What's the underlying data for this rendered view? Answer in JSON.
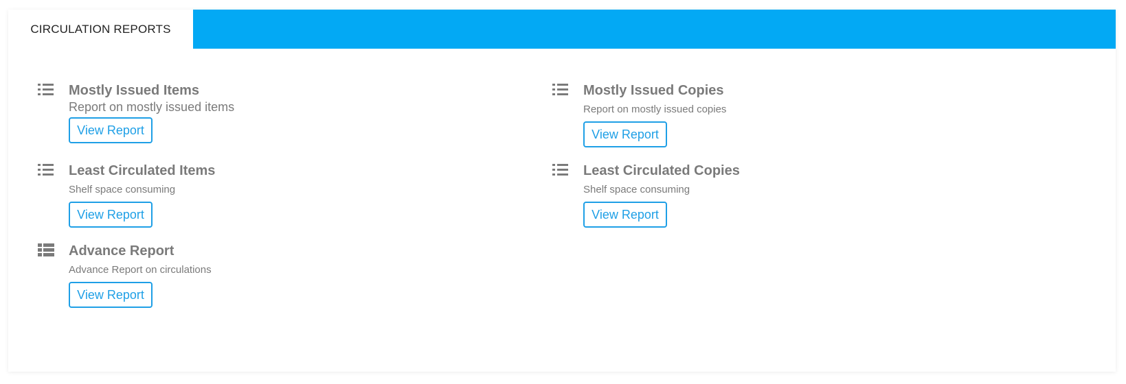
{
  "tab": {
    "label": "CIRCULATION REPORTS"
  },
  "colors": {
    "header_bar": "#03a9f4",
    "button_accent": "#1e9fe6",
    "text_muted": "#7a7a7a"
  },
  "reports": [
    {
      "title": "Mostly Issued Items",
      "description": "Report on mostly issued items",
      "button_label": "View Report",
      "icon": "list-icon"
    },
    {
      "title": "Mostly Issued Copies",
      "description": "Report on mostly issued copies",
      "button_label": "View Report",
      "icon": "list-icon"
    },
    {
      "title": "Least Circulated Items",
      "description": "Shelf space consuming",
      "button_label": "View Report",
      "icon": "list-icon"
    },
    {
      "title": "Least Circulated Copies",
      "description": "Shelf space consuming",
      "button_label": "View Report",
      "icon": "list-icon"
    },
    {
      "title": "Advance Report",
      "description": "Advance Report on circulations",
      "button_label": "View Report",
      "icon": "table-list-icon"
    }
  ]
}
